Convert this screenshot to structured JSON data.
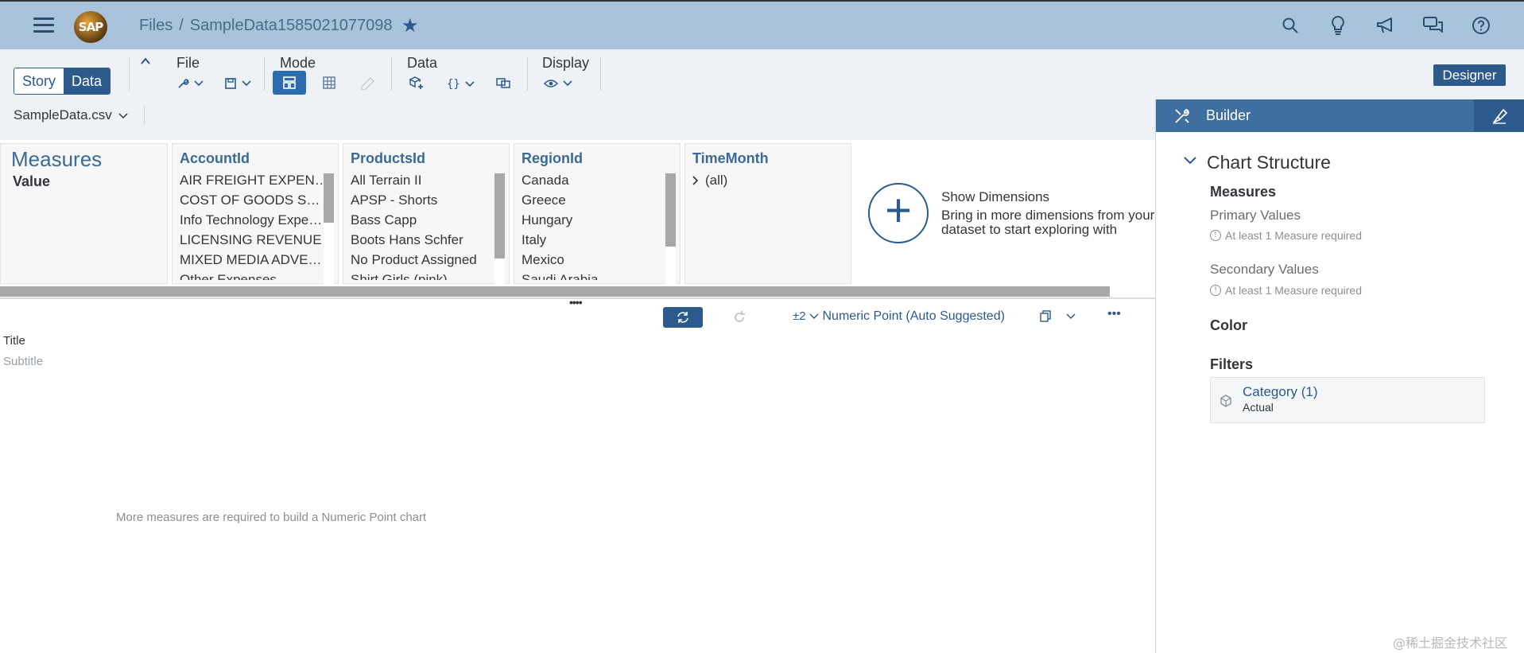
{
  "shell": {
    "logo_text": "SAP",
    "breadcrumb_root": "Files",
    "breadcrumb_sep": "/",
    "file_name": "SampleData1585021077098",
    "icons": [
      "search-icon",
      "lightbulb-icon",
      "megaphone-icon",
      "chat-icon",
      "help-icon"
    ]
  },
  "toolbar": {
    "story_label": "Story",
    "data_label": "Data",
    "file_label": "File",
    "mode_label": "Mode",
    "data_group_label": "Data",
    "display_label": "Display",
    "designer_label": "Designer",
    "dataset_name": "SampleData.csv"
  },
  "panels": {
    "measures": {
      "title": "Measures",
      "value": "Value"
    },
    "account": {
      "title": "AccountId",
      "items": [
        "AIR FREIGHT EXPEN…",
        "COST OF GOODS S…",
        "Info Technology Expe…",
        "LICENSING REVENUE",
        "MIXED MEDIA ADVE…",
        "Other Expenses"
      ]
    },
    "products": {
      "title": "ProductsId",
      "items": [
        "All Terrain II",
        "APSP - Shorts",
        "Bass Capp",
        "Boots Hans Schfer",
        "No Product Assigned",
        "Shirt Girls (pink)"
      ]
    },
    "region": {
      "title": "RegionId",
      "items": [
        "Canada",
        "Greece",
        "Hungary",
        "Italy",
        "Mexico",
        "Saudi Arabia"
      ]
    },
    "time": {
      "title": "TimeMonth",
      "item": "(all)"
    }
  },
  "show_dimensions": {
    "title": "Show Dimensions",
    "description": "Bring in more dimensions from your dataset to start exploring with"
  },
  "chart_toolbar": {
    "chart_type": "Numeric Point (Auto Suggested)"
  },
  "chart": {
    "title_placeholder": "Title",
    "subtitle_placeholder": "Subtitle",
    "message": "More measures are required to build a Numeric Point chart"
  },
  "builder": {
    "title": "Builder",
    "section": "Chart Structure",
    "measures_label": "Measures",
    "primary_values": "Primary Values",
    "secondary_values": "Secondary Values",
    "requirement": "At least 1 Measure required",
    "color_label": "Color",
    "filters_label": "Filters",
    "filter_name": "Category (1)",
    "filter_value": "Actual"
  },
  "watermark": "@稀土掘金技术社区"
}
